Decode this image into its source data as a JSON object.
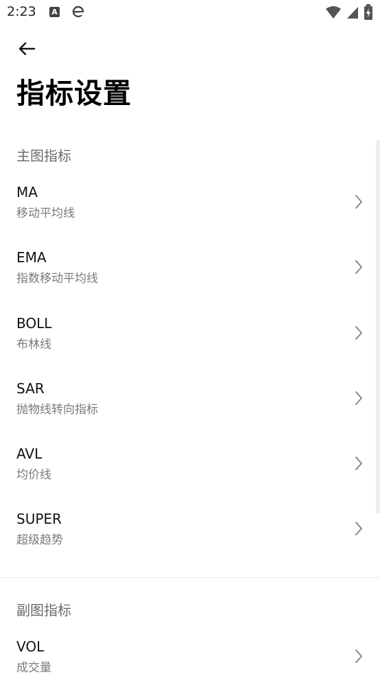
{
  "status_bar": {
    "time": "2:23",
    "notification_icon_a": "A"
  },
  "header": {
    "title": "指标设置"
  },
  "sections": [
    {
      "header": "主图指标",
      "items": [
        {
          "title": "MA",
          "subtitle": "移动平均线"
        },
        {
          "title": "EMA",
          "subtitle": "指数移动平均线"
        },
        {
          "title": "BOLL",
          "subtitle": "布林线"
        },
        {
          "title": "SAR",
          "subtitle": "抛物线转向指标"
        },
        {
          "title": "AVL",
          "subtitle": "均价线"
        },
        {
          "title": "SUPER",
          "subtitle": "超级趋势"
        }
      ]
    },
    {
      "header": "副图指标",
      "items": [
        {
          "title": "VOL",
          "subtitle": "成交量"
        }
      ]
    }
  ]
}
